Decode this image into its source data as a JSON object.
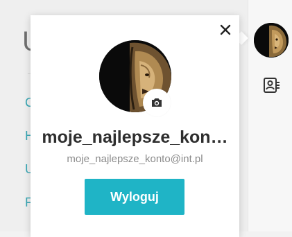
{
  "background": {
    "heading": "U",
    "nav_items": [
      "C",
      "H",
      "U",
      "F"
    ]
  },
  "profile_popup": {
    "username": "moje_najlepsze_kon…",
    "email": "moje_najlepsze_konto@int.pl",
    "logout_label": "Wyloguj",
    "close_icon": "close-icon",
    "camera_icon": "camera-icon"
  },
  "toolbar": {
    "avatar_icon": "lion-avatar",
    "contact_icon": "contact-card-icon"
  },
  "colors": {
    "accent": "#1fb4c6",
    "link": "#39a7b4",
    "text": "#2e2e2e",
    "muted": "#8a8a8a"
  }
}
